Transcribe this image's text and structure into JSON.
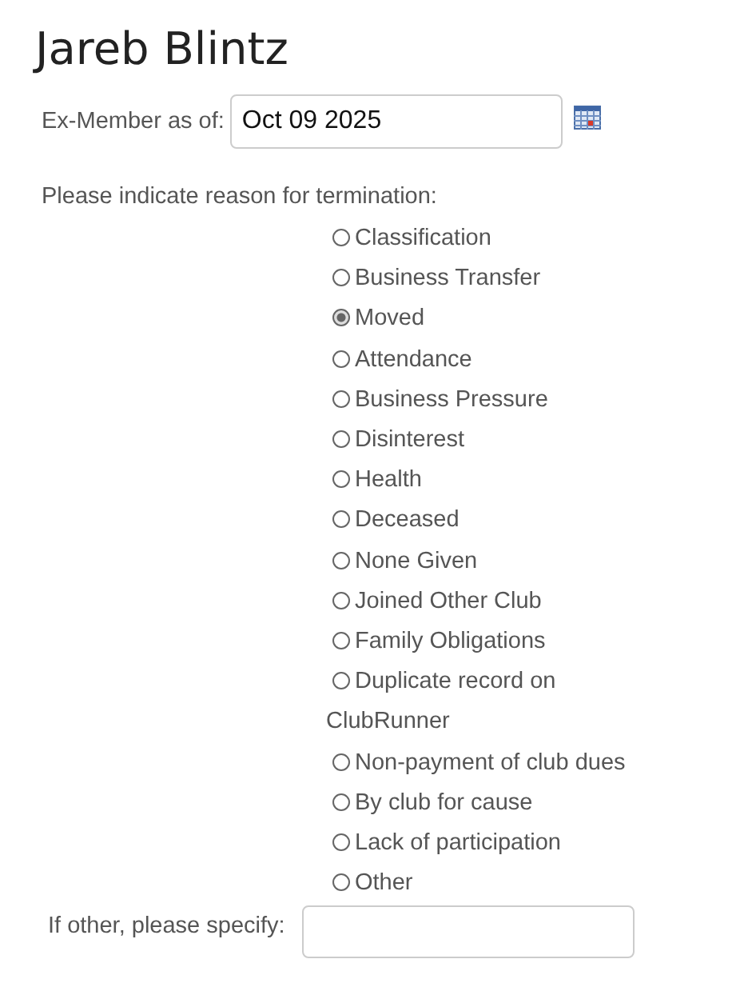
{
  "title": "Jareb Blintz",
  "date_field": {
    "label": "Ex-Member as of:",
    "value": "Oct 09 2025"
  },
  "prompt": "Please indicate reason for termination:",
  "reasons": [
    {
      "label": "Classification",
      "selected": false
    },
    {
      "label": "Business Transfer",
      "selected": false
    },
    {
      "label": "Moved",
      "selected": true
    },
    {
      "label": "Attendance",
      "selected": false
    },
    {
      "label": "Business Pressure",
      "selected": false
    },
    {
      "label": "Disinterest",
      "selected": false
    },
    {
      "label": "Health",
      "selected": false
    },
    {
      "label": "Deceased",
      "selected": false
    },
    {
      "label": "None Given",
      "selected": false
    },
    {
      "label": "Joined Other Club",
      "selected": false
    },
    {
      "label": "Family Obligations",
      "selected": false
    },
    {
      "label": "Duplicate record on ClubRunner",
      "selected": false
    },
    {
      "label": "Non-payment of club dues",
      "selected": false
    },
    {
      "label": "By club for cause",
      "selected": false
    },
    {
      "label": "Lack of participation",
      "selected": false
    },
    {
      "label": "Other",
      "selected": false
    }
  ],
  "other_field": {
    "label": "If other, please specify:"
  }
}
